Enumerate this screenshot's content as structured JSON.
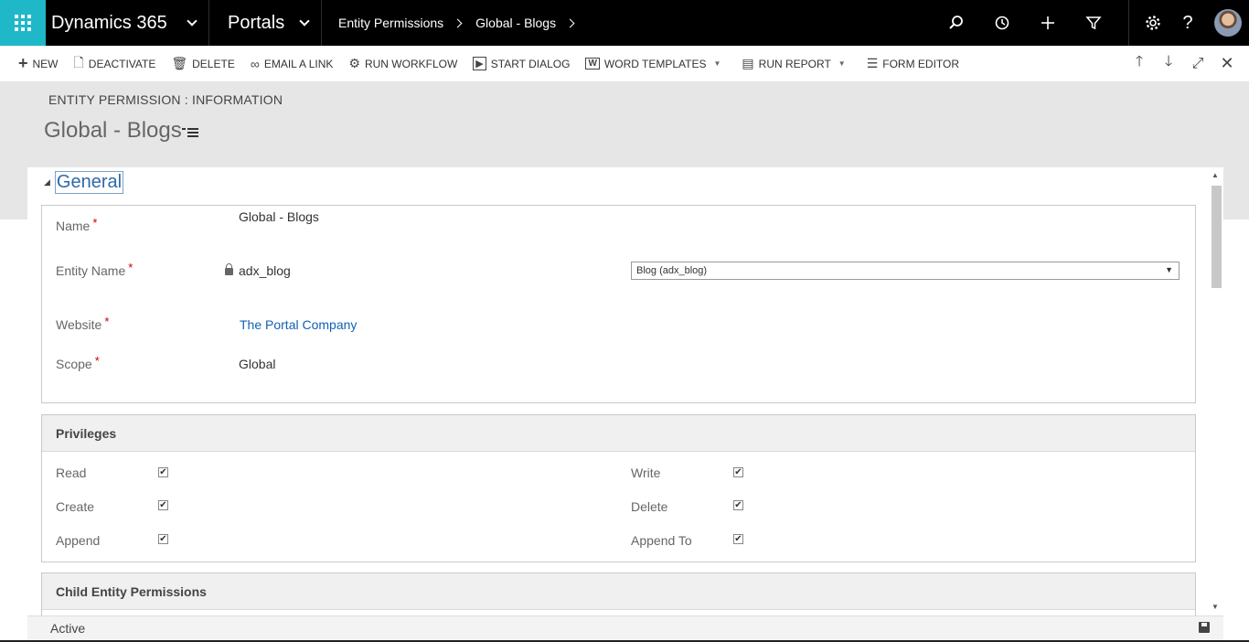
{
  "app": {
    "brand": "Dynamics 365",
    "area": "Portals",
    "breadcrumbs": [
      "Entity Permissions",
      "Global - Blogs"
    ]
  },
  "topbar_icons": [
    "search-icon",
    "history-icon",
    "plus-icon",
    "filter-icon",
    "gear-icon",
    "help-icon"
  ],
  "help_glyph": "?",
  "commands": [
    {
      "label": "NEW",
      "icon": "+"
    },
    {
      "label": "DEACTIVATE",
      "icon": "🗋"
    },
    {
      "label": "DELETE",
      "icon": "🗑"
    },
    {
      "label": "EMAIL A LINK",
      "icon": "∞"
    },
    {
      "label": "RUN WORKFLOW",
      "icon": "⚙"
    },
    {
      "label": "START DIALOG",
      "icon": "▶"
    },
    {
      "label": "WORD TEMPLATES",
      "icon": "W"
    },
    {
      "label": "RUN REPORT",
      "icon": "▤"
    },
    {
      "label": "FORM EDITOR",
      "icon": "☰"
    }
  ],
  "header": {
    "entity_label": "ENTITY PERMISSION : INFORMATION",
    "record_title": "Global - Blogs"
  },
  "general": {
    "title": "General",
    "name_label": "Name",
    "name_value": "Global - Blogs",
    "entity_name_label": "Entity Name",
    "entity_name_value": "adx_blog",
    "entity_select_value": "Blog (adx_blog)",
    "website_label": "Website",
    "website_value": "The Portal Company",
    "scope_label": "Scope",
    "scope_value": "Global",
    "required_mark": "*"
  },
  "privileges": {
    "title": "Privileges",
    "left": [
      {
        "label": "Read",
        "checked": true
      },
      {
        "label": "Create",
        "checked": true
      },
      {
        "label": "Append",
        "checked": true
      }
    ],
    "right": [
      {
        "label": "Write",
        "checked": true
      },
      {
        "label": "Delete",
        "checked": true
      },
      {
        "label": "Append To",
        "checked": true
      }
    ]
  },
  "child_section": {
    "title": "Child Entity Permissions"
  },
  "status": "Active",
  "colors": {
    "accent": "#1eb8c9",
    "link": "#1160b7",
    "required": "#c40000"
  }
}
